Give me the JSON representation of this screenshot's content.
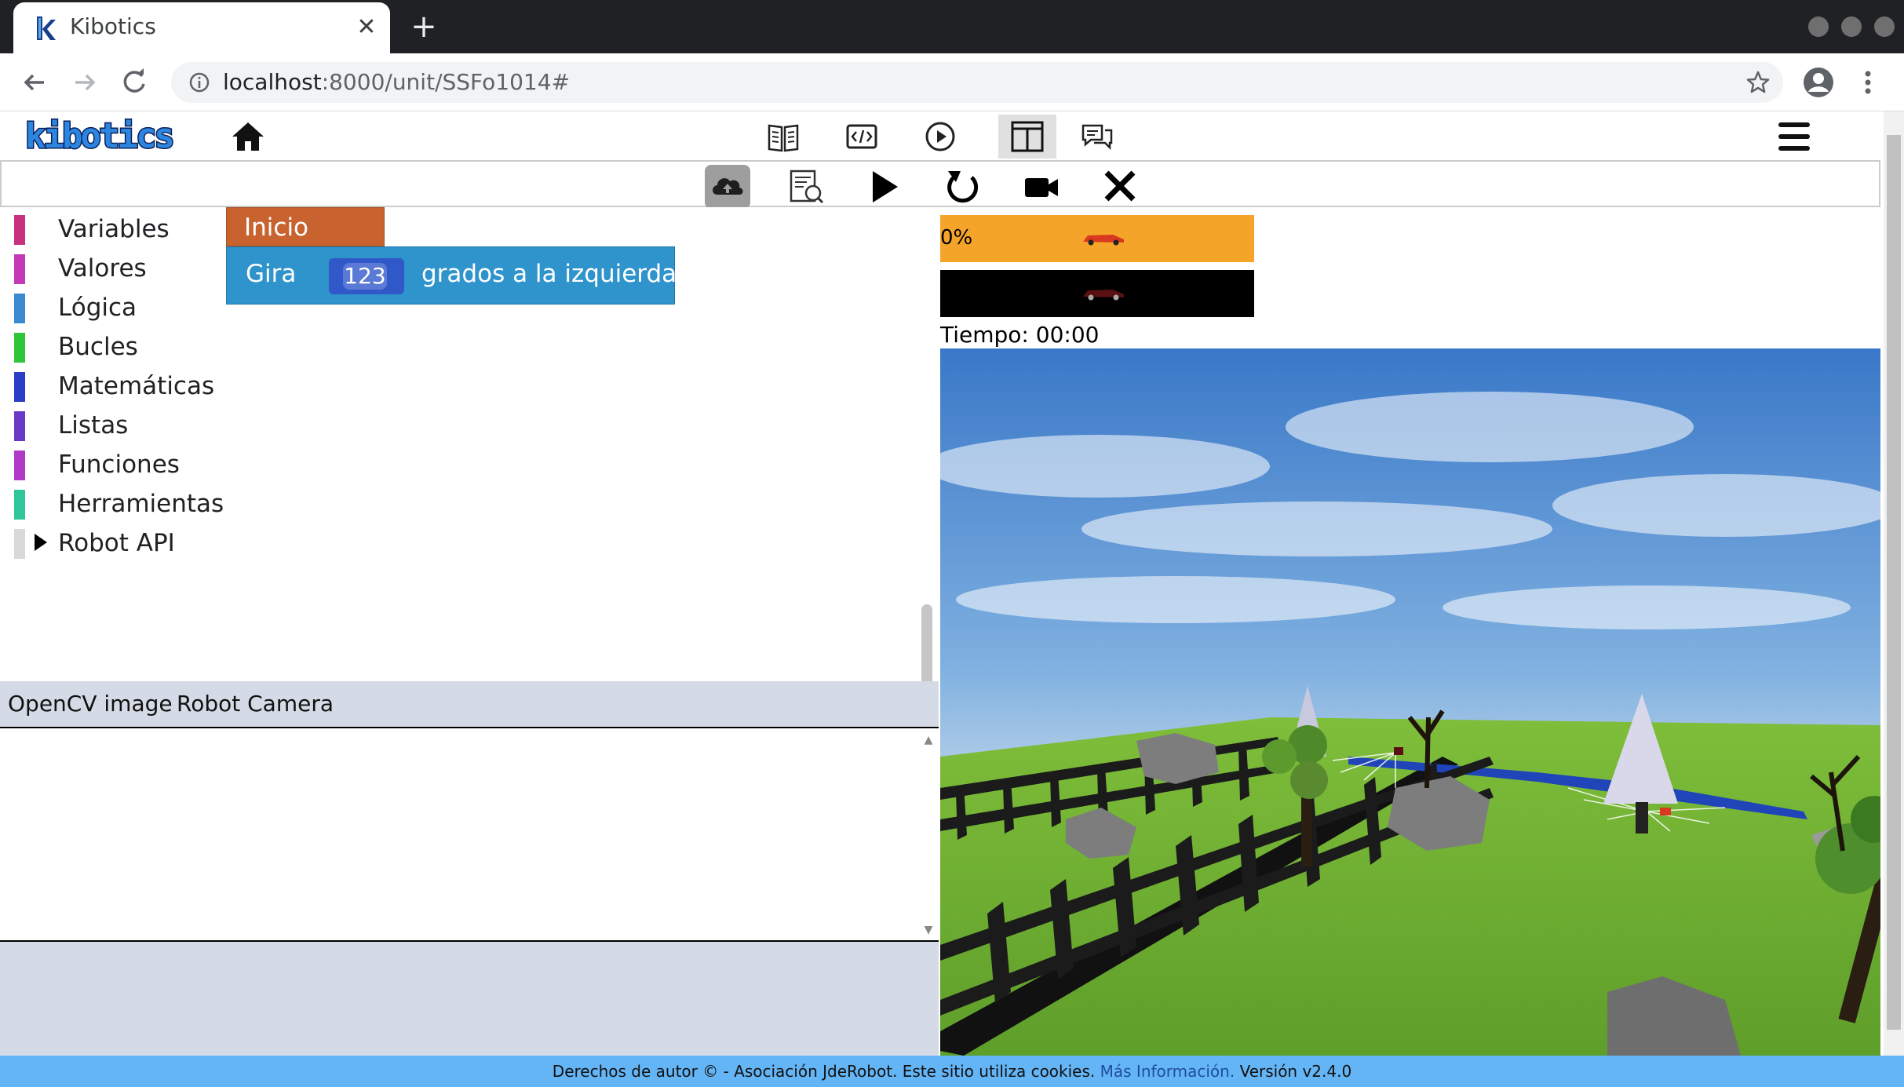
{
  "browser": {
    "tab_title": "Kibotics",
    "url_host": "localhost",
    "url_rest": ":8000/unit/SSFo1014#"
  },
  "app": {
    "logo_text": "kibotics"
  },
  "toolbox": {
    "categories": [
      {
        "label": "Variables",
        "color": "#c8317f"
      },
      {
        "label": "Valores",
        "color": "#c23ab6"
      },
      {
        "label": "Lógica",
        "color": "#3a8ad0"
      },
      {
        "label": "Bucles",
        "color": "#2ec638"
      },
      {
        "label": "Matemáticas",
        "color": "#2a3fc6"
      },
      {
        "label": "Listas",
        "color": "#6a3ac6"
      },
      {
        "label": "Funciones",
        "color": "#b03ac6"
      },
      {
        "label": "Herramientas",
        "color": "#2ec69a"
      },
      {
        "label": "Robot API",
        "color": "#d9d9d9"
      }
    ]
  },
  "blocks": {
    "start_label": "Inicio",
    "turn_prefix": "Gira",
    "turn_value": "123",
    "turn_suffix": "grados a la izquierda"
  },
  "panel": {
    "tab_opencv": "OpenCV image",
    "tab_camera": "Robot Camera"
  },
  "simulator": {
    "progress": "0%",
    "timer": "Tiempo: 00:00"
  },
  "footer": {
    "text": "Derechos de autor © - Asociación JdeRobot. Este sitio utiliza cookies.",
    "link": "Más Información.",
    "version": "Versión v2.4.0"
  }
}
